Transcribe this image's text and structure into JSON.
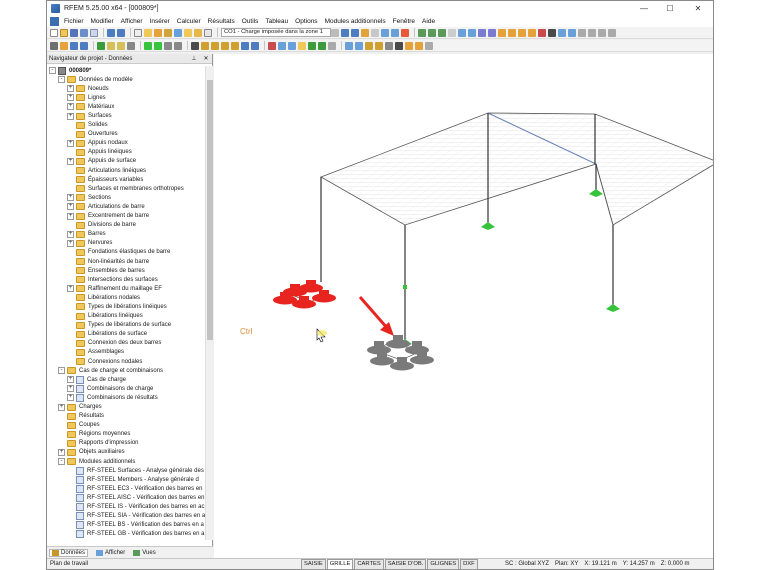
{
  "window": {
    "title": "RFEM 5.25.00 x64 - [000809*]",
    "minimize": "—",
    "maximize": "☐",
    "close": "✕"
  },
  "menu": [
    "Fichier",
    "Modifier",
    "Afficher",
    "Insérer",
    "Calculer",
    "Résultats",
    "Outils",
    "Tableau",
    "Options",
    "Modules additionnels",
    "Fenêtre",
    "Aide"
  ],
  "toolbar": {
    "load_case": "CO1 - Charge imposée dans la zone 1"
  },
  "navigator": {
    "title": "Navigateur de projet - Données",
    "close": "✕",
    "items": [
      {
        "label": "000809*",
        "level": 0,
        "exp": "-",
        "icon": "root"
      },
      {
        "label": "Données de modèle",
        "level": 1,
        "exp": "-",
        "icon": "folder"
      },
      {
        "label": "Noeuds",
        "level": 2,
        "exp": "+",
        "icon": "folder"
      },
      {
        "label": "Lignes",
        "level": 2,
        "exp": "+",
        "icon": "folder"
      },
      {
        "label": "Matériaux",
        "level": 2,
        "exp": "+",
        "icon": "folder"
      },
      {
        "label": "Surfaces",
        "level": 2,
        "exp": "+",
        "icon": "folder"
      },
      {
        "label": "Solides",
        "level": 2,
        "exp": "",
        "icon": "folder"
      },
      {
        "label": "Ouvertures",
        "level": 2,
        "exp": "",
        "icon": "folder"
      },
      {
        "label": "Appuis nodaux",
        "level": 2,
        "exp": "+",
        "icon": "folder"
      },
      {
        "label": "Appuis linéiques",
        "level": 2,
        "exp": "",
        "icon": "folder"
      },
      {
        "label": "Appuis de surface",
        "level": 2,
        "exp": "+",
        "icon": "folder"
      },
      {
        "label": "Articulations linéiques",
        "level": 2,
        "exp": "",
        "icon": "folder"
      },
      {
        "label": "Épaisseurs variables",
        "level": 2,
        "exp": "",
        "icon": "folder"
      },
      {
        "label": "Surfaces et membranes orthotropes",
        "level": 2,
        "exp": "",
        "icon": "folder"
      },
      {
        "label": "Sections",
        "level": 2,
        "exp": "+",
        "icon": "folder"
      },
      {
        "label": "Articulations de barre",
        "level": 2,
        "exp": "+",
        "icon": "folder"
      },
      {
        "label": "Excentrement de barre",
        "level": 2,
        "exp": "+",
        "icon": "folder"
      },
      {
        "label": "Divisions de barre",
        "level": 2,
        "exp": "",
        "icon": "folder"
      },
      {
        "label": "Barres",
        "level": 2,
        "exp": "+",
        "icon": "folder"
      },
      {
        "label": "Nervures",
        "level": 2,
        "exp": "+",
        "icon": "folder"
      },
      {
        "label": "Fondations élastiques de barre",
        "level": 2,
        "exp": "",
        "icon": "folder"
      },
      {
        "label": "Non-linéarités de barre",
        "level": 2,
        "exp": "",
        "icon": "folder"
      },
      {
        "label": "Ensembles de barres",
        "level": 2,
        "exp": "",
        "icon": "folder"
      },
      {
        "label": "Intersections des surfaces",
        "level": 2,
        "exp": "",
        "icon": "folder"
      },
      {
        "label": "Raffinement du maillage EF",
        "level": 2,
        "exp": "+",
        "icon": "folder"
      },
      {
        "label": "Libérations nodales",
        "level": 2,
        "exp": "",
        "icon": "folder"
      },
      {
        "label": "Types de libérations linéiques",
        "level": 2,
        "exp": "",
        "icon": "folder"
      },
      {
        "label": "Libérations linéiques",
        "level": 2,
        "exp": "",
        "icon": "folder"
      },
      {
        "label": "Types de libérations de surface",
        "level": 2,
        "exp": "",
        "icon": "folder"
      },
      {
        "label": "Libérations de surface",
        "level": 2,
        "exp": "",
        "icon": "folder"
      },
      {
        "label": "Connexion des deux barres",
        "level": 2,
        "exp": "",
        "icon": "folder"
      },
      {
        "label": "Assemblages",
        "level": 2,
        "exp": "",
        "icon": "folder"
      },
      {
        "label": "Connexions nodales",
        "level": 2,
        "exp": "",
        "icon": "folder"
      },
      {
        "label": "Cas de charge et combinaisons",
        "level": 1,
        "exp": "-",
        "icon": "folder"
      },
      {
        "label": "Cas de charge",
        "level": 2,
        "exp": "+",
        "icon": "item"
      },
      {
        "label": "Combinaisons de charge",
        "level": 2,
        "exp": "+",
        "icon": "item"
      },
      {
        "label": "Combinaisons de résultats",
        "level": 2,
        "exp": "+",
        "icon": "item"
      },
      {
        "label": "Charges",
        "level": 1,
        "exp": "+",
        "icon": "folder"
      },
      {
        "label": "Résultats",
        "level": 1,
        "exp": "",
        "icon": "folder"
      },
      {
        "label": "Coupes",
        "level": 1,
        "exp": "",
        "icon": "folder"
      },
      {
        "label": "Régions moyennes",
        "level": 1,
        "exp": "",
        "icon": "folder"
      },
      {
        "label": "Rapports d'impression",
        "level": 1,
        "exp": "",
        "icon": "folder"
      },
      {
        "label": "Objets auxiliaires",
        "level": 1,
        "exp": "+",
        "icon": "folder"
      },
      {
        "label": "Modules additionnels",
        "level": 1,
        "exp": "-",
        "icon": "folder"
      },
      {
        "label": "RF-STEEL Surfaces - Analyse générale des",
        "level": 2,
        "exp": "",
        "icon": "item"
      },
      {
        "label": "RF-STEEL Members - Analyse générale d",
        "level": 2,
        "exp": "",
        "icon": "item"
      },
      {
        "label": "RF-STEEL EC3 - Vérification des barres en",
        "level": 2,
        "exp": "",
        "icon": "item"
      },
      {
        "label": "RF-STEEL AISC - Vérification des barres en",
        "level": 2,
        "exp": "",
        "icon": "item"
      },
      {
        "label": "RF-STEEL IS - Vérification des barres en ac",
        "level": 2,
        "exp": "",
        "icon": "item"
      },
      {
        "label": "RF-STEEL SIA - Vérification des barres en a",
        "level": 2,
        "exp": "",
        "icon": "item"
      },
      {
        "label": "RF-STEEL BS - Vérification des barres en a",
        "level": 2,
        "exp": "",
        "icon": "item"
      },
      {
        "label": "RF-STEEL GB - Vérification des barres en a",
        "level": 2,
        "exp": "",
        "icon": "item"
      }
    ],
    "tabs": [
      "Données",
      "Afficher",
      "Vues"
    ]
  },
  "viewport": {
    "ctrl_label": "Ctrl"
  },
  "status": {
    "left": "Plan de travail",
    "buttons": [
      "SAISIE",
      "GRILLE",
      "CARTES",
      "SAISIE D'OB.",
      "GLIGNES",
      "DXF"
    ],
    "active_button": "GRILLE",
    "sc": "SC : Global XYZ",
    "plan": "Plan: XY",
    "x": "X:  19.121 m",
    "y": "Y:  14.257 m",
    "z": "Z:  0.000 m"
  },
  "colors": {
    "accent": "#3b6db1",
    "support_selected": "#e8241f",
    "support_green": "#36c43c",
    "support_gray": "#7a7a7a",
    "arrow": "#e8241f"
  }
}
